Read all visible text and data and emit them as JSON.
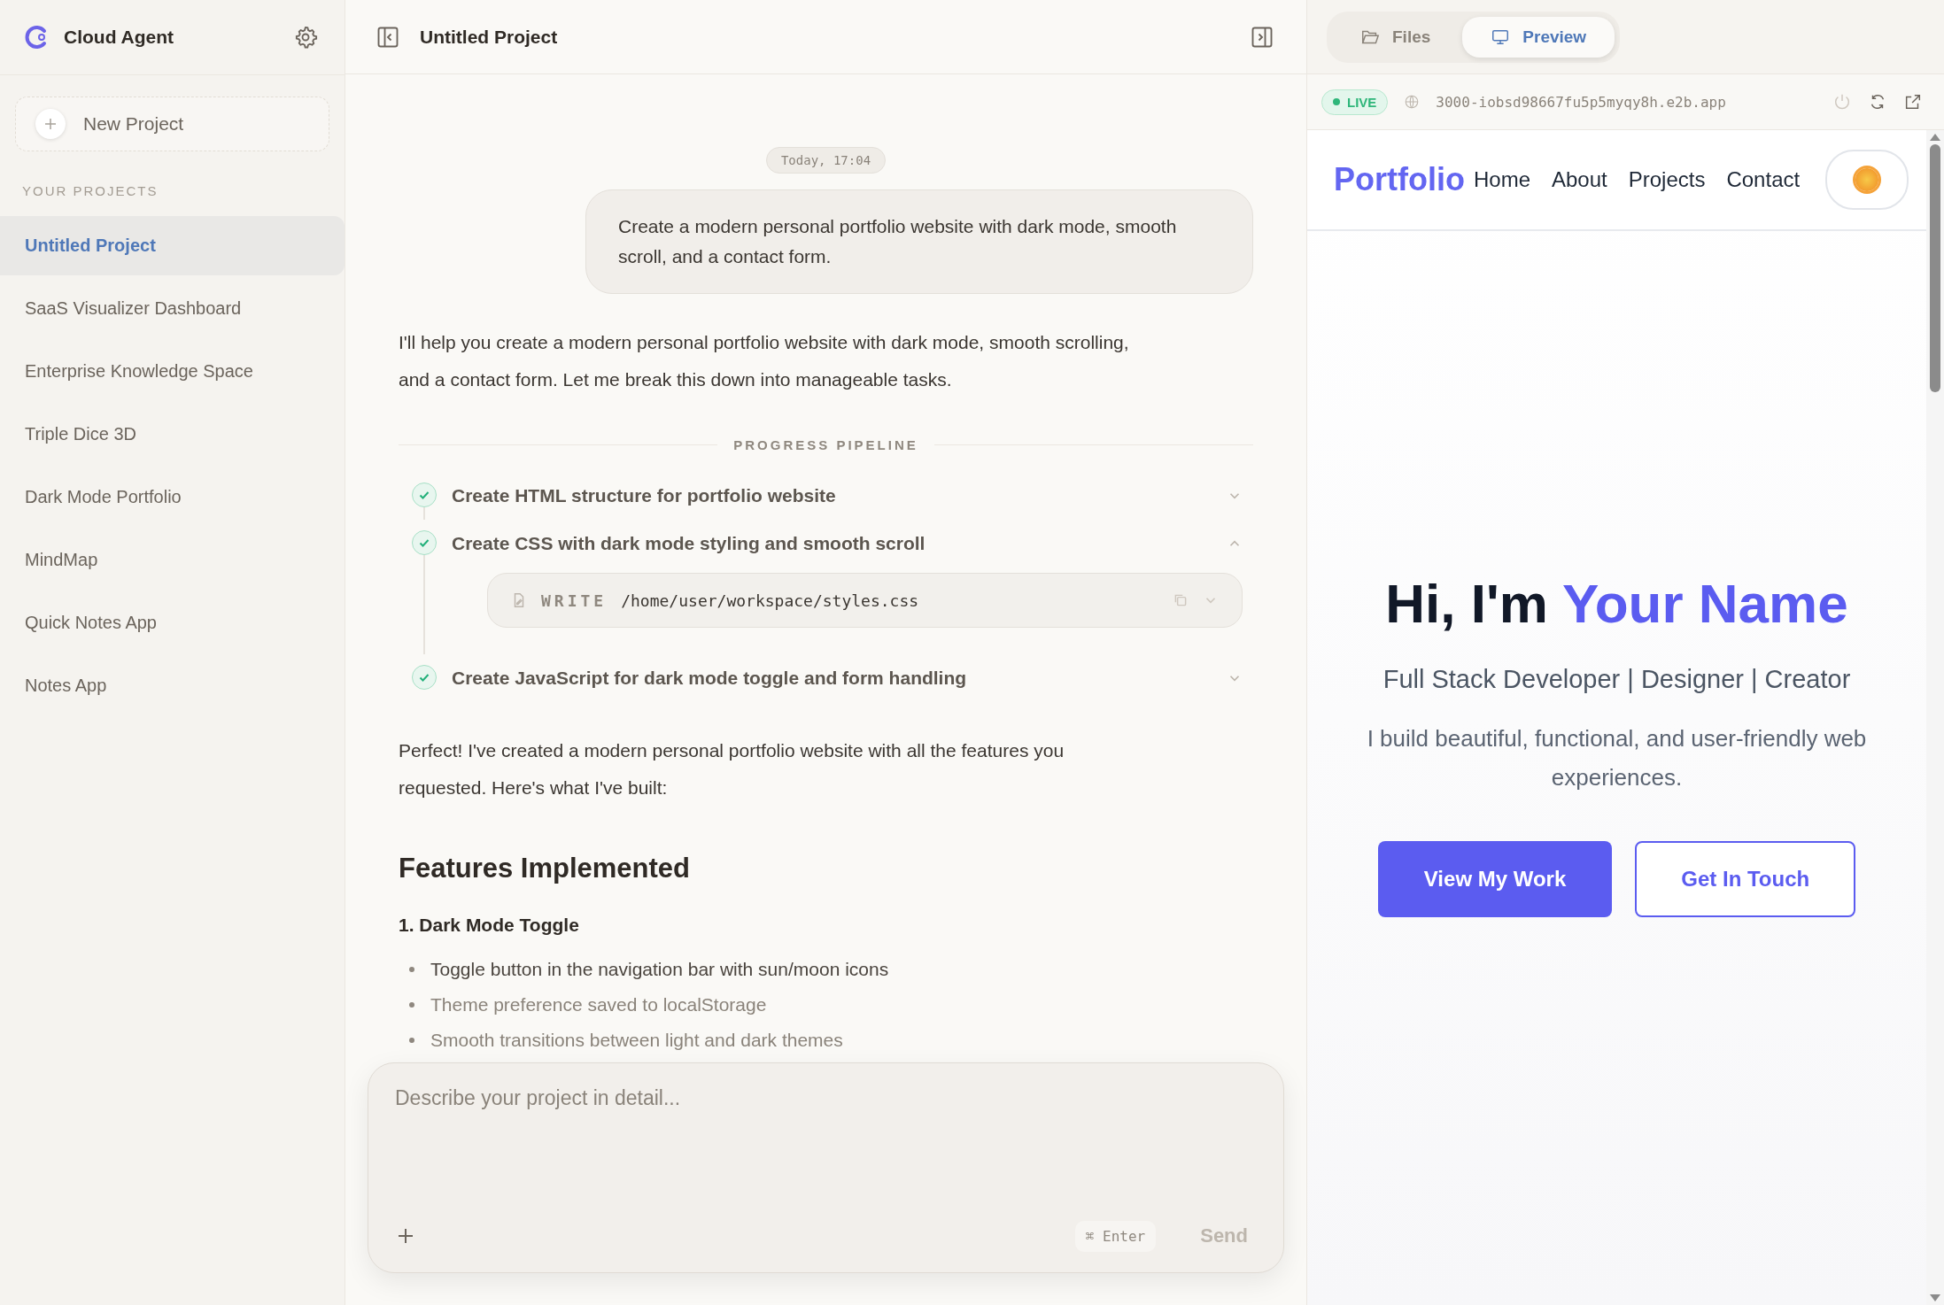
{
  "sidebar": {
    "app_name": "Cloud Agent",
    "new_project": "New Project",
    "section_label": "YOUR PROJECTS",
    "projects": [
      {
        "name": "Untitled Project",
        "selected": true
      },
      {
        "name": "SaaS Visualizer Dashboard",
        "selected": false
      },
      {
        "name": "Enterprise Knowledge Space",
        "selected": false
      },
      {
        "name": "Triple Dice 3D",
        "selected": false
      },
      {
        "name": "Dark Mode Portfolio",
        "selected": false
      },
      {
        "name": "MindMap",
        "selected": false
      },
      {
        "name": "Quick Notes App",
        "selected": false
      },
      {
        "name": "Notes App",
        "selected": false
      }
    ]
  },
  "header": {
    "title": "Untitled Project"
  },
  "chat": {
    "timestamp": "Today, 17:04",
    "user_message": "Create a modern personal portfolio website with dark mode, smooth scroll, and a contact form.",
    "intro": "I'll help you create a modern personal portfolio website with dark mode, smooth scrolling, and a contact form. Let me break this down into manageable tasks.",
    "pipeline": {
      "label": "PROGRESS PIPELINE",
      "steps": [
        {
          "title": "Create HTML structure for portfolio website",
          "done": true,
          "expanded": false
        },
        {
          "title": "Create CSS with dark mode styling and smooth scroll",
          "done": true,
          "expanded": true,
          "action": {
            "verb": "WRITE",
            "path": "/home/user/workspace/styles.css"
          }
        },
        {
          "title": "Create JavaScript for dark mode toggle and form handling",
          "done": true,
          "expanded": false
        }
      ]
    },
    "summary": "Perfect! I've created a modern personal portfolio website with all the features you requested. Here's what I've built:",
    "heading": "Features Implemented",
    "subheading": "1. Dark Mode Toggle",
    "bullets": [
      "Toggle button in the navigation bar with sun/moon icons",
      "Theme preference saved to localStorage",
      "Smooth transitions between light and dark themes"
    ]
  },
  "composer": {
    "placeholder": "Describe your project in detail...",
    "shortcut": "⌘ Enter",
    "send": "Send",
    "send_disabled": true
  },
  "right_panel": {
    "tabs": [
      {
        "label": "Files",
        "selected": false
      },
      {
        "label": "Preview",
        "selected": true
      }
    ],
    "status": "LIVE",
    "url": "3000-iobsd98667fu5p5myqy8h.e2b.app",
    "preview": {
      "logo": "Portfolio",
      "nav": [
        "Home",
        "About",
        "Projects",
        "Contact"
      ],
      "title_prefix": "Hi, I'm",
      "title_highlight": "Your Name",
      "subtitle": "Full Stack Developer | Designer | Creator",
      "description": "I build beautiful, functional, and user-friendly web experiences.",
      "buttons": [
        {
          "label": "View My Work",
          "kind": "primary"
        },
        {
          "label": "Get In Touch",
          "kind": "outline"
        }
      ]
    }
  }
}
